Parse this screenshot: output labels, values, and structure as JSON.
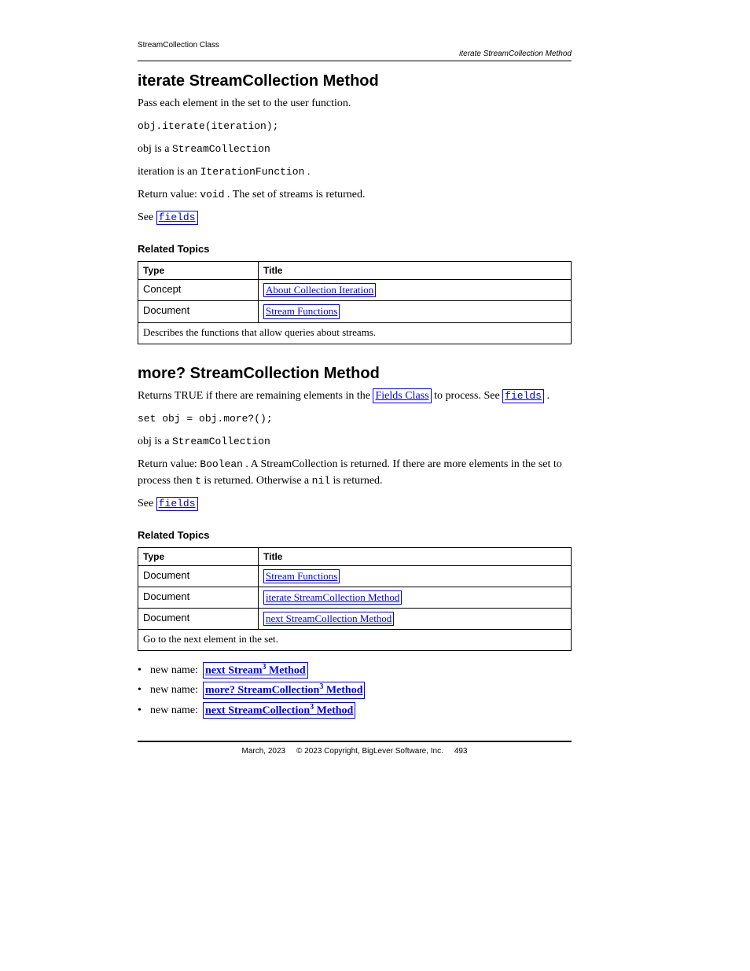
{
  "header": {
    "left": "StreamCollection Class",
    "right": "iterate StreamCollection Method"
  },
  "sections": [
    {
      "title": "iterate StreamCollection Method",
      "desc": "Pass each element in the set to the user function.",
      "signature": "obj.iterate(iteration);",
      "obj_lead": "obj is a ",
      "obj_type": "StreamCollection",
      "iter_lead": "iteration is an ",
      "iter_type": "IterationFunction",
      "iter_tail": ".",
      "return_lead": "Return value: ",
      "return_void": "void",
      "return_tail": ". The set of streams is returned.",
      "see_label": "See ",
      "see_link": "fields",
      "related_heading": "Related Topics",
      "table": {
        "cols": [
          "Type",
          "Title"
        ],
        "rows": [
          {
            "type": "Concept",
            "title": "About Collection Iteration"
          },
          {
            "type": "Document",
            "title": "Stream Functions",
            "desc": "Describes the functions that allow queries about streams."
          }
        ]
      }
    },
    {
      "title": "more? StreamCollection Method",
      "desc1": "Returns TRUE if there are remaining elements in the ",
      "link1": "Fields Class",
      "desc2": " to process. See ",
      "link2": "fields",
      "desc3": ".",
      "signature": "set obj = obj.more?();",
      "obj_lead": "obj is a ",
      "obj_type": "StreamCollection",
      "return_lead": "Return value: ",
      "return_type": "Boolean",
      "return_more": ". A StreamCollection is returned. If there are more elements in the set to process then ",
      "return_t": "t",
      "return_tail": " is returned. Otherwise a ",
      "return_nil": "nil",
      "return_after": " is returned.",
      "see_label": "See ",
      "see_link": "fields",
      "related_heading": "Related Topics",
      "table": {
        "cols": [
          "Type",
          "Title"
        ],
        "rows": [
          {
            "type": "Document",
            "title": "Stream Functions"
          },
          {
            "type": "Document",
            "title": "iterate StreamCollection Method"
          },
          {
            "type": "Document",
            "title": "next StreamCollection Method",
            "desc": "Go to the next element in the set."
          }
        ]
      },
      "bullets": [
        {
          "pre": "new name:",
          "link_text": "next Stream",
          "sup": "3",
          "link_suffix": " Method"
        },
        {
          "pre": "new name:",
          "link_text": "more? StreamCollection",
          "sup": "3",
          "link_suffix": " Method"
        },
        {
          "pre": "new name:",
          "link_text": "next StreamCollection",
          "sup": "3",
          "link_suffix": " Method"
        }
      ]
    }
  ],
  "footer": {
    "date": "March, 2023",
    "copyright": "© 2023 Copyright, BigLever Software, Inc.",
    "page": "493"
  }
}
